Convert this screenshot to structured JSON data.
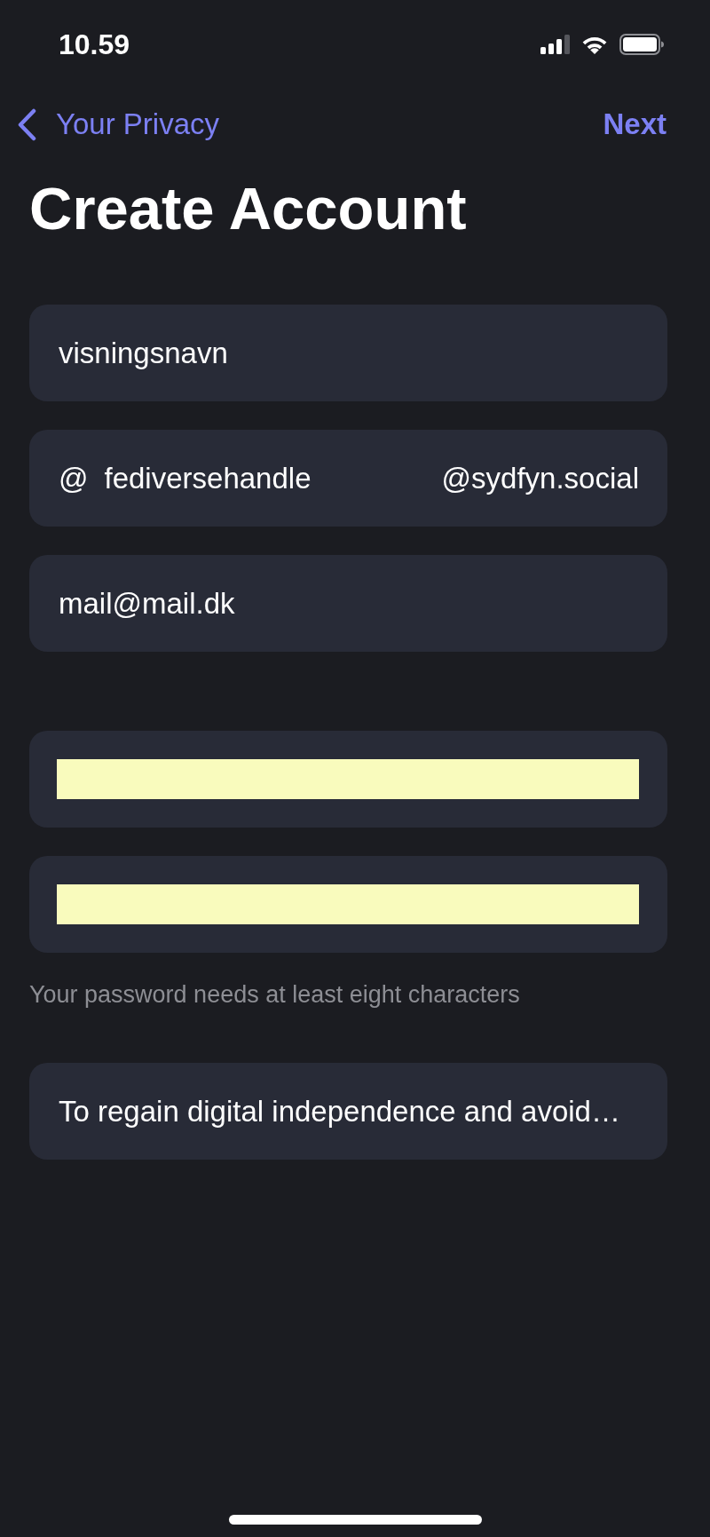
{
  "status_bar": {
    "time": "10.59"
  },
  "nav": {
    "back_label": "Your Privacy",
    "action": "Next"
  },
  "title": "Create Account",
  "account_fields": [
    {
      "kind": "text",
      "value": "visningsnavn"
    },
    {
      "kind": "handle",
      "prefix": "@",
      "value": "fediversehandle",
      "suffix": "@sydfyn.social"
    },
    {
      "kind": "email",
      "value": "mail@mail.dk"
    }
  ],
  "password_fields": [
    {
      "kind": "password",
      "autofilled": true
    },
    {
      "kind": "password",
      "autofilled": true
    }
  ],
  "password_hint": "Your password needs at least eight characters",
  "reason_field": {
    "value": "To regain digital independence and avoid…"
  }
}
